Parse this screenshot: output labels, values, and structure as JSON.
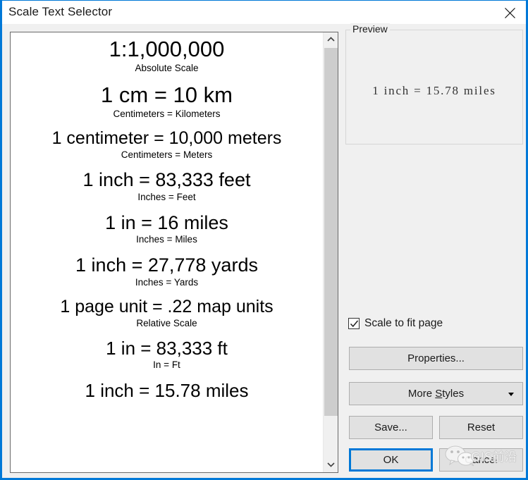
{
  "window": {
    "title": "Scale Text Selector",
    "close_icon": "close-icon",
    "accent_color": "#0078d7",
    "background_color": "#f0f0f0"
  },
  "scale_list": {
    "items": [
      {
        "main": "1:1,000,000",
        "sub": "Absolute Scale",
        "main_size": "31px"
      },
      {
        "main": "1 cm = 10 km",
        "sub": "Centimeters = Kilometers",
        "main_size": "31px"
      },
      {
        "main": "1 centimeter = 10,000 meters",
        "sub": "Centimeters = Meters",
        "main_size": "25px"
      },
      {
        "main": "1 inch = 83,333 feet",
        "sub": "Inches = Feet",
        "main_size": "27px"
      },
      {
        "main": "1 in = 16 miles",
        "sub": "Inches = Miles",
        "main_size": "27px"
      },
      {
        "main": "1 inch = 27,778 yards",
        "sub": "Inches = Yards",
        "main_size": "27px"
      },
      {
        "main": "1 page unit = .22 map units",
        "sub": "Relative Scale",
        "main_size": "25px"
      },
      {
        "main": "1 in = 83,333 ft",
        "sub": "In = Ft",
        "main_size": "26px"
      },
      {
        "main": "1 inch = 15.78 miles",
        "sub": "",
        "main_size": "26px"
      }
    ]
  },
  "scrollbar": {
    "up_icon": "chevron-up-icon",
    "down_icon": "chevron-down-icon",
    "thumb_name": "scrollbar-thumb"
  },
  "preview": {
    "legend": "Preview",
    "text": "1 inch = 15.78 miles"
  },
  "options": {
    "fit_page_label": "Scale to fit page",
    "fit_page_checked": true,
    "check_icon": "check-icon"
  },
  "buttons": {
    "properties": "Properties...",
    "more_styles_prefix": "More ",
    "more_styles_accel": "S",
    "more_styles_suffix": "tyles",
    "more_styles_dropdown_icon": "caret-down-icon",
    "save": "Save...",
    "reset": "Reset",
    "ok": "OK",
    "cancel": "Cancel"
  },
  "watermark": {
    "text": "GIS前沿",
    "logo_icon": "wechat-icon"
  }
}
